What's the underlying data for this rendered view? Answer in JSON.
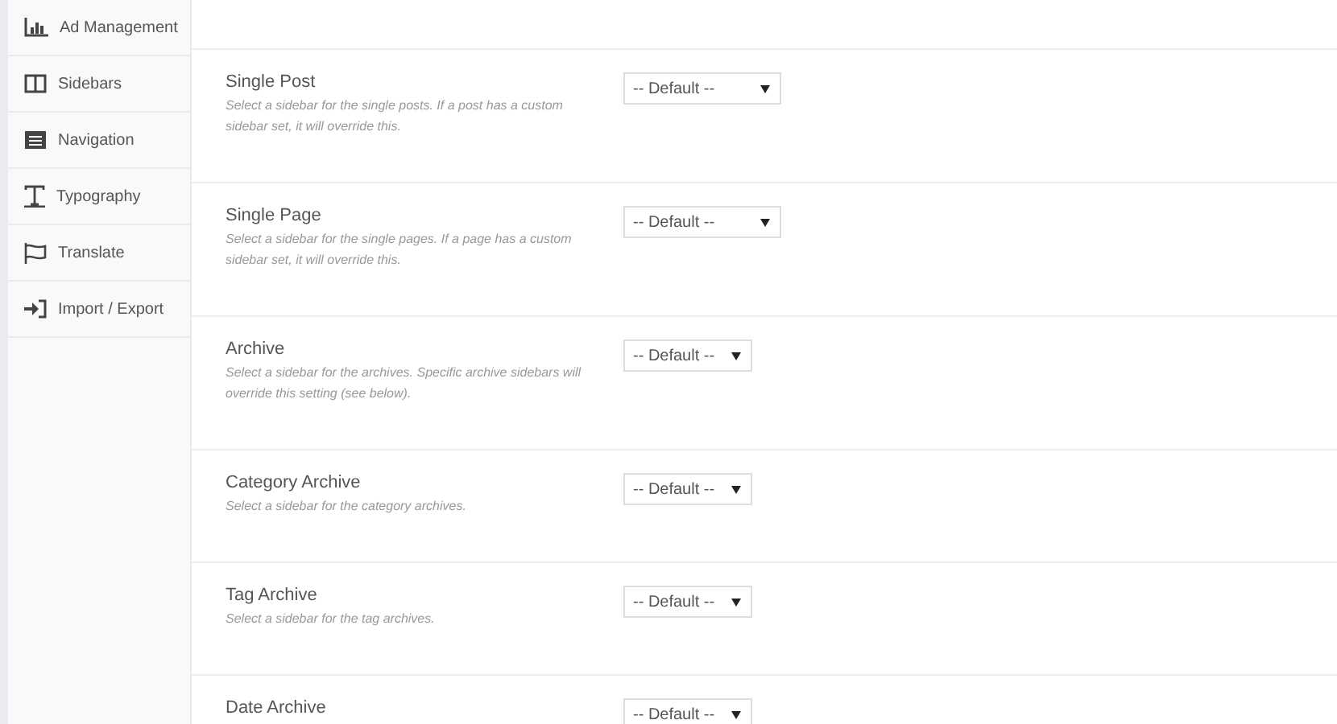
{
  "sidebar": {
    "items": [
      {
        "label": "Ad Management",
        "selected": false
      },
      {
        "label": "Sidebars",
        "selected": false
      },
      {
        "label": "Navigation",
        "selected": false
      },
      {
        "label": "Typography",
        "selected": false
      },
      {
        "label": "Translate",
        "selected": false
      },
      {
        "label": "Import / Export",
        "selected": false
      }
    ]
  },
  "settings": [
    {
      "label": "Single Post",
      "description": "Select a sidebar for the single posts. If a post has a custom sidebar set, it will override this.",
      "value": "-- Default --"
    },
    {
      "label": "Single Page",
      "description": "Select a sidebar for the single pages. If a page has a custom sidebar set, it will override this.",
      "value": "-- Default --"
    },
    {
      "label": "Archive",
      "description": "Select a sidebar for the archives. Specific archive sidebars will override this setting (see below).",
      "value": "-- Default --"
    },
    {
      "label": "Category Archive",
      "description": "Select a sidebar for the category archives.",
      "value": "-- Default --"
    },
    {
      "label": "Tag Archive",
      "description": "Select a sidebar for the tag archives.",
      "value": "-- Default --"
    },
    {
      "label": "Date Archive",
      "value": "-- Default --"
    }
  ]
}
